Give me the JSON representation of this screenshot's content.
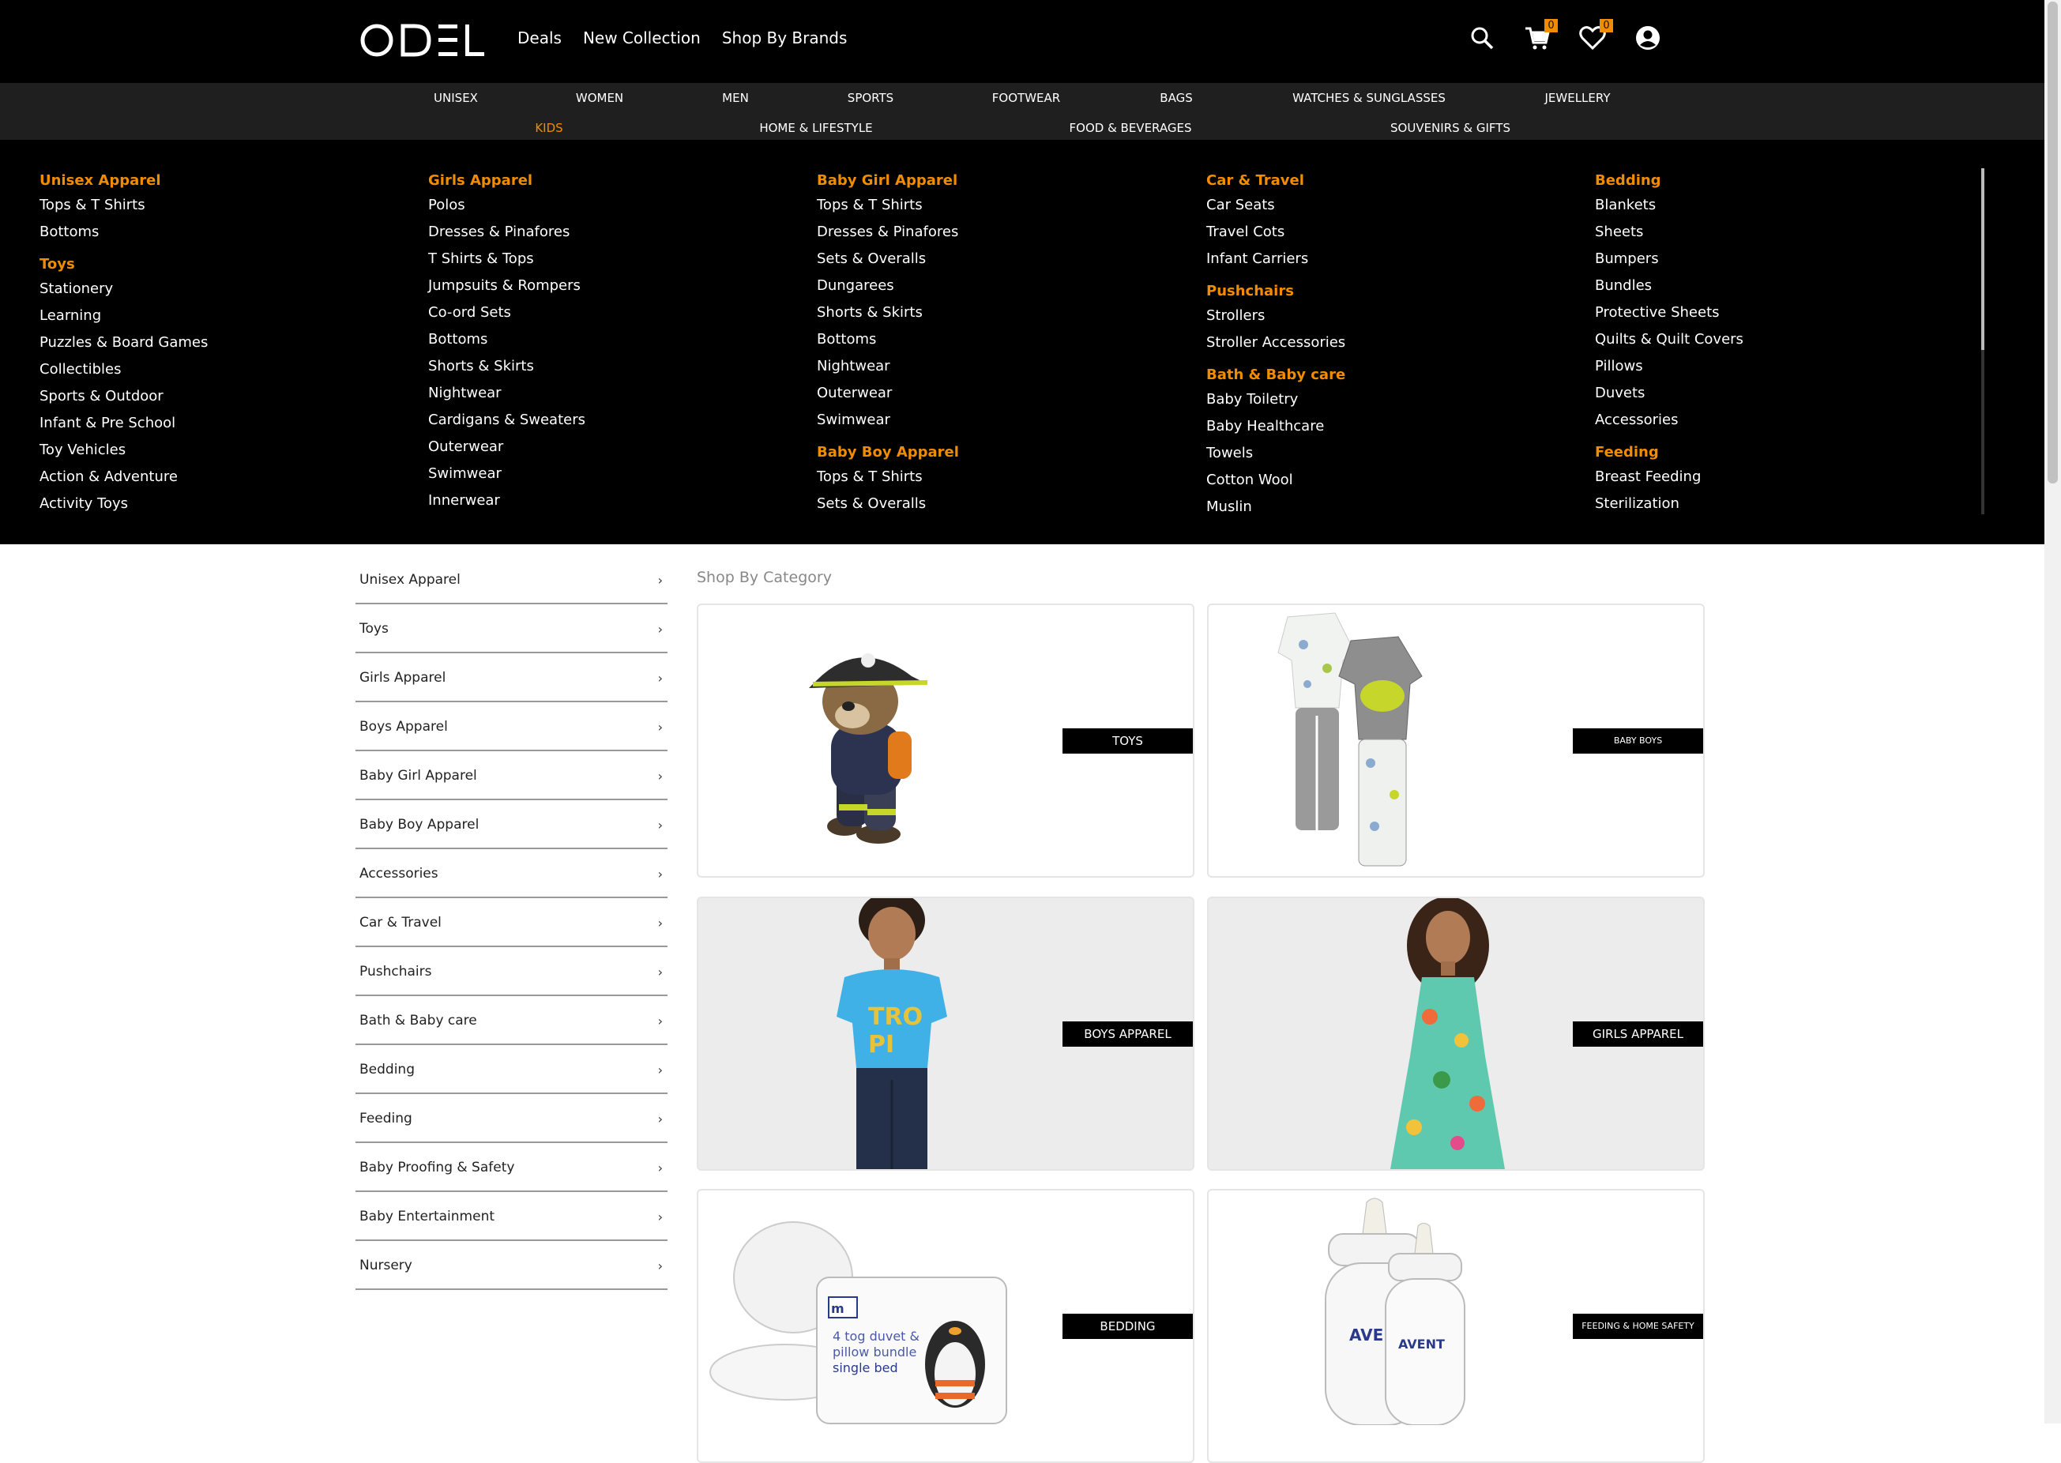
{
  "header": {
    "logo": "ODEL",
    "nav": [
      "Deals",
      "New Collection",
      "Shop By Brands"
    ],
    "cart_count": "0",
    "wishlist_count": "0"
  },
  "categories": {
    "row1": [
      "UNISEX",
      "WOMEN",
      "MEN",
      "SPORTS",
      "FOOTWEAR",
      "BAGS",
      "WATCHES & SUNGLASSES",
      "JEWELLERY"
    ],
    "row2": [
      "KIDS",
      "HOME & LIFESTYLE",
      "FOOD & BEVERAGES",
      "SOUVENIRS & GIFTS"
    ],
    "active": "KIDS"
  },
  "mega_menu": {
    "columns": [
      [
        {
          "title": "Unisex Apparel",
          "items": [
            "Tops & T Shirts",
            "Bottoms"
          ]
        },
        {
          "title": "Toys",
          "items": [
            "Stationery",
            "Learning",
            "Puzzles & Board Games",
            "Collectibles",
            "Sports & Outdoor",
            "Infant & Pre School",
            "Toy Vehicles",
            "Action & Adventure",
            "Activity Toys"
          ]
        }
      ],
      [
        {
          "title": "Girls Apparel",
          "items": [
            "Polos",
            "Dresses & Pinafores",
            "T Shirts & Tops",
            "Jumpsuits & Rompers",
            "Co-ord Sets",
            "Bottoms",
            "Shorts & Skirts",
            "Nightwear",
            "Cardigans & Sweaters",
            "Outerwear",
            "Swimwear",
            "Innerwear"
          ]
        }
      ],
      [
        {
          "title": "Baby Girl Apparel",
          "items": [
            "Tops & T Shirts",
            "Dresses & Pinafores",
            "Sets & Overalls",
            "Dungarees",
            "Shorts & Skirts",
            "Bottoms",
            "Nightwear",
            "Outerwear",
            "Swimwear"
          ]
        },
        {
          "title": "Baby Boy Apparel",
          "items": [
            "Tops & T Shirts",
            "Sets & Overalls"
          ]
        }
      ],
      [
        {
          "title": "Car & Travel",
          "items": [
            "Car Seats",
            "Travel Cots",
            "Infant Carriers"
          ]
        },
        {
          "title": "Pushchairs",
          "items": [
            "Strollers",
            "Stroller Accessories"
          ]
        },
        {
          "title": "Bath & Baby care",
          "items": [
            "Baby Toiletry",
            "Baby Healthcare",
            "Towels",
            "Cotton Wool",
            "Muslin"
          ]
        }
      ],
      [
        {
          "title": "Bedding",
          "items": [
            "Blankets",
            "Sheets",
            "Bumpers",
            "Bundles",
            "Protective Sheets",
            "Quilts & Quilt Covers",
            "Pillows",
            "Duvets",
            "Accessories"
          ]
        },
        {
          "title": "Feeding",
          "items": [
            "Breast Feeding",
            "Sterilization"
          ]
        }
      ]
    ]
  },
  "sidebar": {
    "items": [
      "Unisex Apparel",
      "Toys",
      "Girls Apparel",
      "Boys Apparel",
      "Baby Girl Apparel",
      "Baby Boy Apparel",
      "Accessories",
      "Car & Travel",
      "Pushchairs",
      "Bath & Baby care",
      "Bedding",
      "Feeding",
      "Baby Proofing & Safety",
      "Baby Entertainment",
      "Nursery"
    ]
  },
  "content": {
    "title": "Shop By Category",
    "cards": [
      "TOYS",
      "BABY BOYS",
      "BOYS APPAREL",
      "GIRLS APPAREL",
      "BEDDING",
      "FEEDING & HOME SAFETY"
    ],
    "pillow_text": [
      "4 tog duvet &",
      "pillow bundle",
      "single bed"
    ],
    "bottle_text": "AVENT"
  }
}
